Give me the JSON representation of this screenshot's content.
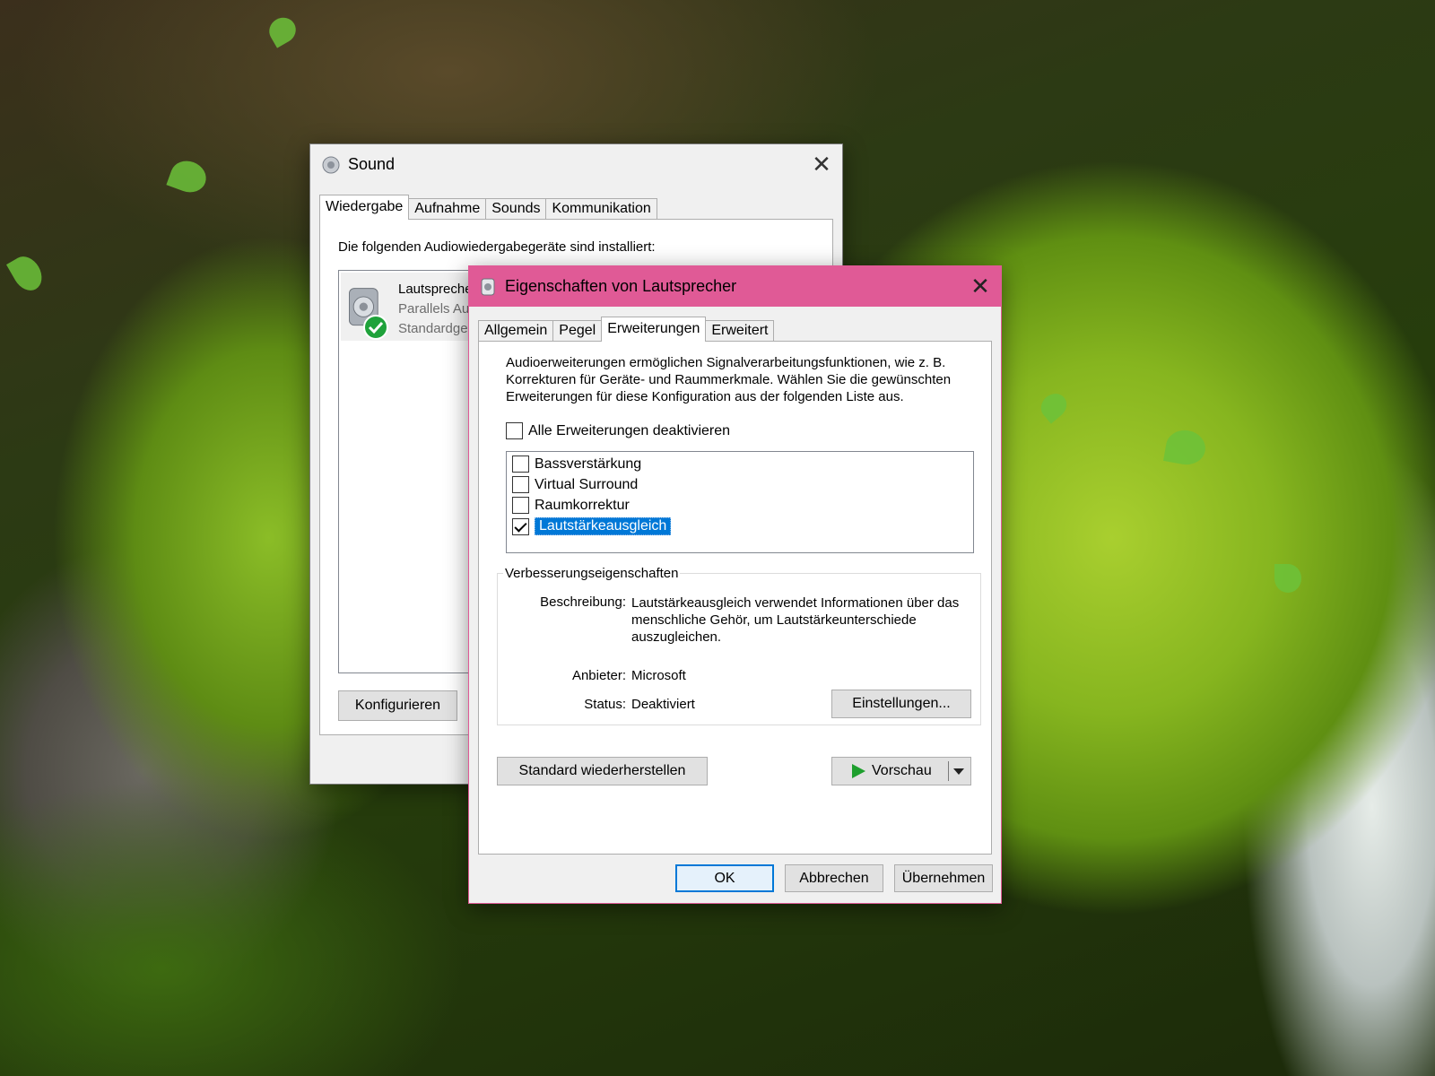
{
  "sound_window": {
    "title": "Sound",
    "tabs": [
      "Wiedergabe",
      "Aufnahme",
      "Sounds",
      "Kommunikation"
    ],
    "active_tab": "Wiedergabe",
    "intro": "Die folgenden Audiowiedergabegeräte sind installiert:",
    "device": {
      "name": "Lautspreche",
      "driver": "Parallels Au",
      "status": "Standardge"
    },
    "configure_button": "Konfigurieren"
  },
  "properties_window": {
    "title": "Eigenschaften von Lautsprecher",
    "accent_color": "#e05a96",
    "tabs": [
      "Allgemein",
      "Pegel",
      "Erweiterungen",
      "Erweitert"
    ],
    "active_tab": "Erweiterungen",
    "description": "Audioerweiterungen ermöglichen Signalverarbeitungsfunktionen, wie z. B. Korrekturen für Geräte- und Raummerkmale. Wählen Sie die gewünschten Erweiterungen für diese Konfiguration aus der folgenden Liste aus.",
    "disable_all_label": "Alle Erweiterungen deaktivieren",
    "disable_all_checked": false,
    "enhancements": [
      {
        "label": "Bassverstärkung",
        "checked": false,
        "selected": false
      },
      {
        "label": "Virtual Surround",
        "checked": false,
        "selected": false
      },
      {
        "label": "Raumkorrektur",
        "checked": false,
        "selected": false
      },
      {
        "label": "Lautstärkeausgleich",
        "checked": true,
        "selected": true
      }
    ],
    "group_title": "Verbesserungseigenschaften",
    "desc_label": "Beschreibung:",
    "desc_value": "Lautstärkeausgleich verwendet Informationen über das menschliche Gehör, um Lautstärkeunterschiede auszugleichen.",
    "provider_label": "Anbieter:",
    "provider_value": "Microsoft",
    "status_label": "Status:",
    "status_value": "Deaktiviert",
    "settings_button": "Einstellungen...",
    "restore_button": "Standard wiederherstellen",
    "preview_button": "Vorschau",
    "ok_button": "OK",
    "cancel_button": "Abbrechen",
    "apply_button": "Übernehmen"
  }
}
